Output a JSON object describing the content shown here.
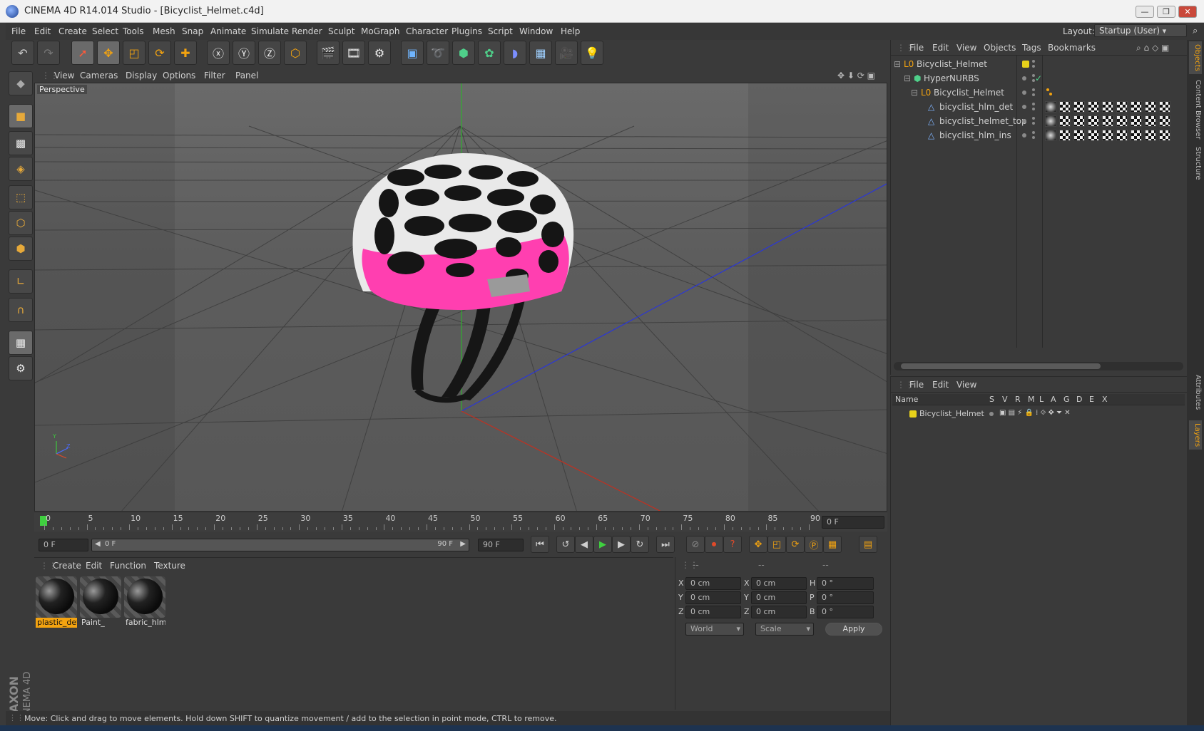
{
  "window": {
    "title": "CINEMA 4D R14.014 Studio - [Bicyclist_Helmet.c4d]",
    "minimize": "—",
    "maximize": "❐",
    "close": "✕"
  },
  "menubar": {
    "items": [
      "File",
      "Edit",
      "Create",
      "Select",
      "Tools",
      "Mesh",
      "Snap",
      "Animate",
      "Simulate",
      "Render",
      "Sculpt",
      "MoGraph",
      "Character",
      "Plugins",
      "Script",
      "Window",
      "Help"
    ],
    "layout_label": "Layout:",
    "layout_value": "Startup (User)"
  },
  "viewport": {
    "menu": [
      "View",
      "Cameras",
      "Display",
      "Options",
      "Filter",
      "Panel"
    ],
    "label": "Perspective",
    "axis_y": "Y",
    "axis_z": "Z"
  },
  "timeline": {
    "ticks": [
      "0",
      "5",
      "10",
      "15",
      "20",
      "25",
      "30",
      "35",
      "40",
      "45",
      "50",
      "55",
      "60",
      "65",
      "70",
      "75",
      "80",
      "85",
      "90"
    ],
    "current_frame": "0 F",
    "start_field": "0 F",
    "range_start": "0 F",
    "range_end": "90 F",
    "end_field": "90 F"
  },
  "materials": {
    "menu": [
      "Create",
      "Edit",
      "Function",
      "Texture"
    ],
    "items": [
      {
        "name": "plastic_det",
        "selected": true
      },
      {
        "name": "Paint_",
        "selected": false
      },
      {
        "name": "fabric_hlm",
        "selected": false
      }
    ]
  },
  "coordinates": {
    "headers": [
      "--",
      "--",
      "--"
    ],
    "rows": [
      {
        "a_label": "X",
        "a_value": "0 cm",
        "b_label": "X",
        "b_value": "0 cm",
        "c_label": "H",
        "c_value": "0 °"
      },
      {
        "a_label": "Y",
        "a_value": "0 cm",
        "b_label": "Y",
        "b_value": "0 cm",
        "c_label": "P",
        "c_value": "0 °"
      },
      {
        "a_label": "Z",
        "a_value": "0 cm",
        "b_label": "Z",
        "b_value": "0 cm",
        "c_label": "B",
        "c_value": "0 °"
      }
    ],
    "space_select": "World",
    "mode_select": "Scale",
    "apply_label": "Apply"
  },
  "status": "Move: Click and drag to move elements. Hold down SHIFT to quantize movement / add to the selection in point mode, CTRL to remove.",
  "object_manager": {
    "menu": [
      "File",
      "Edit",
      "View",
      "Objects",
      "Tags",
      "Bookmarks"
    ],
    "objects": [
      {
        "name": "Bicyclist_Helmet",
        "icon": "null-object-icon"
      },
      {
        "name": "HyperNURBS",
        "icon": "hypernurbs-icon"
      },
      {
        "name": "Bicyclist_Helmet",
        "icon": "null-object-icon"
      },
      {
        "name": "bicyclist_hlm_det",
        "icon": "polygon-object-icon"
      },
      {
        "name": "bicyclist_helmet_top",
        "icon": "polygon-object-icon"
      },
      {
        "name": "bicyclist_hlm_ins",
        "icon": "polygon-object-icon"
      }
    ]
  },
  "layer_manager": {
    "menu": [
      "File",
      "Edit",
      "View"
    ],
    "columns": [
      "Name",
      "S",
      "V",
      "R",
      "M",
      "L",
      "A",
      "G",
      "D",
      "E",
      "X"
    ],
    "layers": [
      {
        "name": "Bicyclist_Helmet",
        "color": "#e8d21a"
      }
    ]
  },
  "side_tabs": [
    "Objects",
    "Content Browser",
    "Structure",
    "Attributes",
    "Layers"
  ],
  "brand": {
    "maxon": "MAXON",
    "product": "CINEMA 4D"
  },
  "colors": {
    "accent_orange": "#f3a310",
    "helmet_pink": "#ff3fb0",
    "layer_yellow": "#e8d21a"
  }
}
